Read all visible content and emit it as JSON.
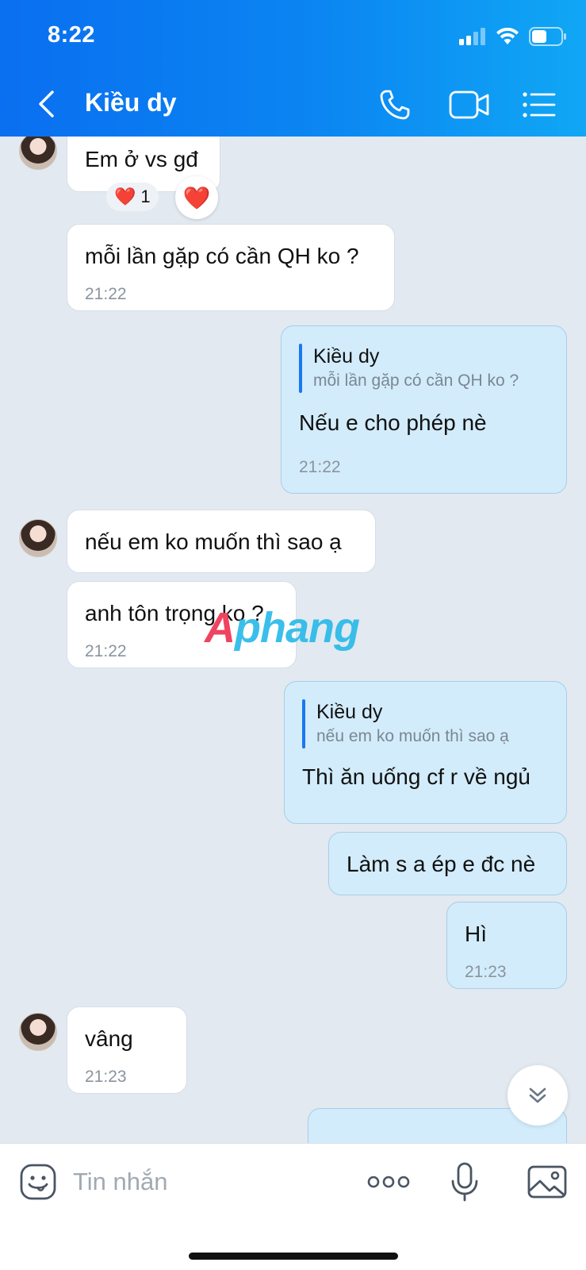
{
  "status_bar": {
    "time": "8:22"
  },
  "header": {
    "title": "Kiều dy",
    "back_icon": "chevron-left-icon",
    "call_icon": "phone-icon",
    "video_icon": "video-camera-icon",
    "menu_icon": "list-menu-icon"
  },
  "messages": [
    {
      "dir": "in",
      "text": "Em ở vs gđ",
      "reaction": "❤️",
      "reaction_count": "1",
      "reaction_button": "❤️"
    },
    {
      "dir": "in",
      "text": "mỗi lần gặp có cần QH ko ?",
      "time": "21:22"
    },
    {
      "dir": "out",
      "quote_name": "Kiều dy",
      "quote_text": "mỗi lần gặp có cần QH ko ?",
      "text": "Nếu e cho phép nè",
      "time": "21:22"
    },
    {
      "dir": "in",
      "text": "nếu em ko muốn thì sao ạ"
    },
    {
      "dir": "in",
      "text": "anh tôn trọng ko ?",
      "time": "21:22"
    },
    {
      "dir": "out",
      "quote_name": "Kiều dy",
      "quote_text": "nếu em ko muốn thì sao ạ",
      "text": "Thì ăn uống cf r về ngủ"
    },
    {
      "dir": "out",
      "text": "Làm s a ép e đc nè"
    },
    {
      "dir": "out",
      "text": "Hì",
      "time": "21:23"
    },
    {
      "dir": "in",
      "text": "vâng",
      "time": "21:23"
    }
  ],
  "watermark": {
    "first": "A",
    "rest": "phang"
  },
  "input_bar": {
    "placeholder": "Tin nhắn",
    "emoji_icon": "sticker-face-icon",
    "more_icon": "more-dots-icon",
    "mic_icon": "microphone-icon",
    "image_icon": "image-gallery-icon"
  },
  "colors": {
    "header_start": "#0a6ff0",
    "header_end": "#10a7f5",
    "chat_bg": "#e2e9f1",
    "incoming_bubble": "#ffffff",
    "outgoing_bubble": "#d2ecfb",
    "accent": "#1877f2"
  }
}
